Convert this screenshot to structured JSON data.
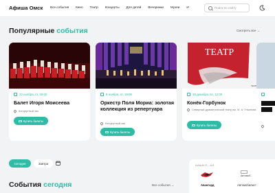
{
  "header": {
    "logo": "Афиша Омск",
    "nav": [
      "Все события",
      "Кино",
      "Театр",
      "Концерты",
      "Для детей",
      "Вечеринки",
      "Музеи",
      "И"
    ],
    "search_placeholder": "Поиск по сайту",
    "theme_icon": "moon-icon"
  },
  "popular": {
    "title": "Популярные",
    "title_accent": "события",
    "see_all": "Смотреть все →"
  },
  "cards": [
    {
      "date": "22 ноября, пт, 19:00",
      "title": "Балет Игоря Моисеева",
      "venue": "Концертный зал",
      "button": "Купить билеты"
    },
    {
      "date": "8 ноября, пт, 19:00",
      "title": "Оркестр Поля Мориа: золотая коллекция из репертуара",
      "venue": "Концертный зал",
      "button": "Купить билеты"
    },
    {
      "date": "30 декабря, вс, 12:00",
      "title": "Конёк-Горбунок",
      "venue": "Северный драматический театр им. М. А. Ульянова",
      "button": "Купить билеты",
      "image_text": "ТЕАТР"
    }
  ],
  "filters": {
    "today": "Сегодня",
    "tomorrow": "Завтра",
    "calendar_icon": "calendar-icon"
  },
  "today_section": {
    "title": "События",
    "title_accent": "сегодня",
    "see_all": "Все события →"
  },
  "partners": {
    "title": "НАШИ П...АЛ",
    "items": [
      {
        "name": "Авангард"
      },
      {
        "name": "Автомобилист",
        "logo_text": "Автомоб..."
      }
    ]
  },
  "colors": {
    "accent": "#2fbba6",
    "background": "#f2f3f5"
  }
}
